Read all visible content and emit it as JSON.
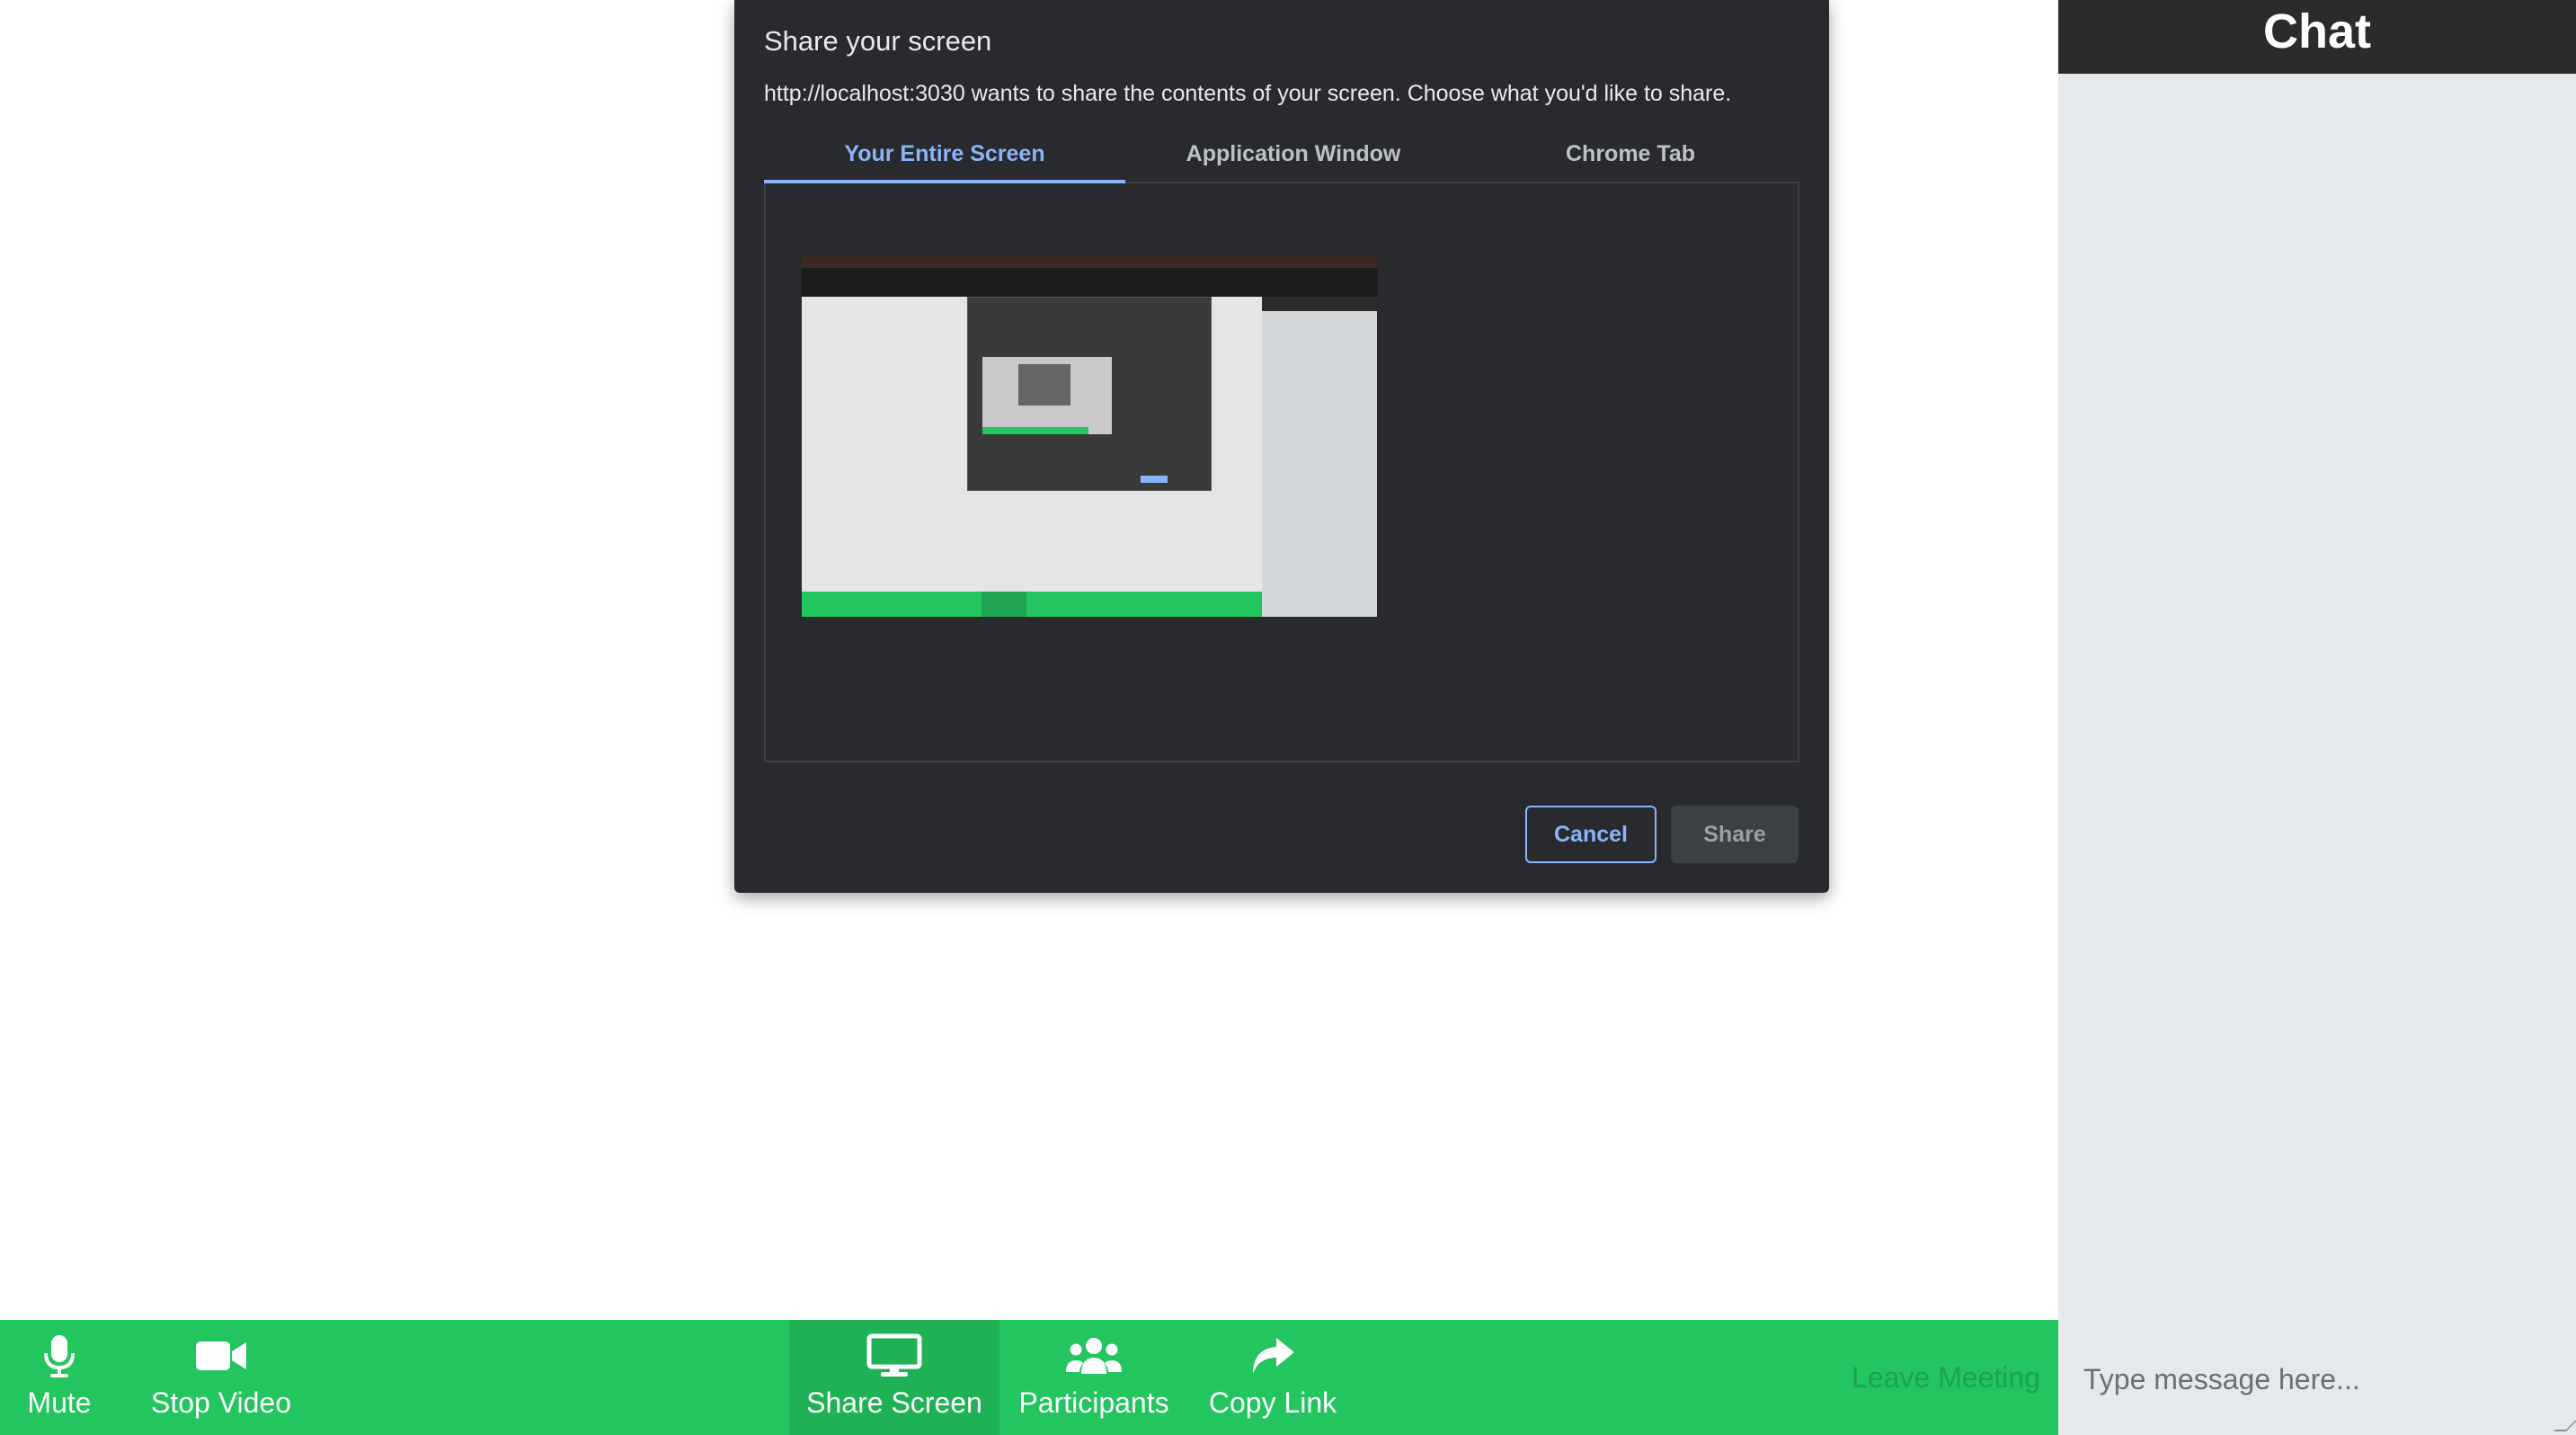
{
  "dialog": {
    "title": "Share your screen",
    "description": "http://localhost:3030 wants to share the contents of your screen. Choose what you'd like to share.",
    "tabs": [
      {
        "label": "Your Entire Screen",
        "selected": true
      },
      {
        "label": "Application Window",
        "selected": false
      },
      {
        "label": "Chrome Tab",
        "selected": false
      }
    ],
    "cancel_label": "Cancel",
    "share_label": "Share",
    "accent_color": "#8ab4f8",
    "background_color": "#292a2d"
  },
  "chat": {
    "title": "Chat",
    "input_placeholder": "Type message here..."
  },
  "toolbar": {
    "background_color": "#22c55e",
    "mute_label": "Mute",
    "stop_video_label": "Stop Video",
    "share_screen_label": "Share Screen",
    "participants_label": "Participants",
    "copy_link_label": "Copy Link",
    "leave_label": "Leave Meeting"
  },
  "icons": {
    "mute": "microphone-icon",
    "video": "video-camera-icon",
    "share": "monitor-icon",
    "participants": "users-icon",
    "copy_link": "share-arrow-icon"
  }
}
